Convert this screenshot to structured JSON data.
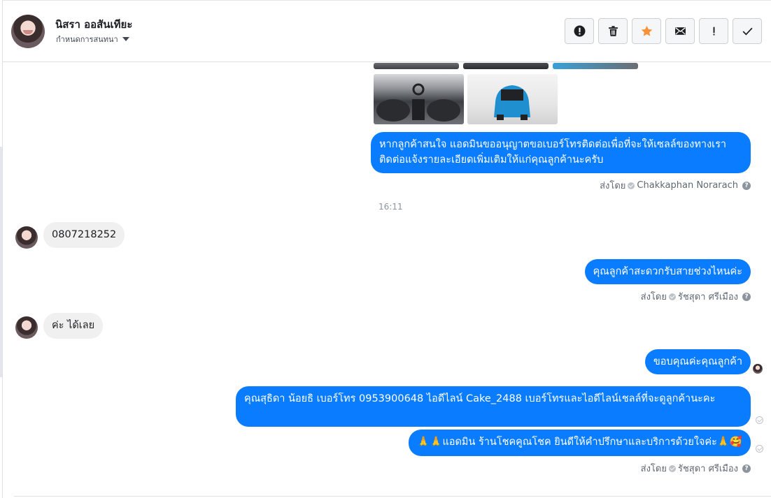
{
  "header": {
    "contact_name": "นิสรา ออสันเทียะ",
    "contact_sub": "กำหนดการสนทนา",
    "actions": [
      {
        "name": "report-spam-button",
        "icon": "alert-circle-icon"
      },
      {
        "name": "delete-button",
        "icon": "trash-icon"
      },
      {
        "name": "star-button",
        "icon": "star-icon"
      },
      {
        "name": "mark-unread-button",
        "icon": "envelope-icon"
      },
      {
        "name": "mark-important-button",
        "icon": "exclamation-icon"
      },
      {
        "name": "mark-done-button",
        "icon": "checkmark-icon"
      }
    ]
  },
  "colors": {
    "outgoing_bubble": "#0a7cff",
    "incoming_bubble": "#f0f0f0",
    "star": "#f7923b"
  },
  "messages": {
    "msg1": "หากลูกค้าสนใจ แอดมินขออนุญาตขอเบอร์โทรติดต่อเพื่อที่จะให้เซลล์ของทางเราติดต่อแจ้งรายละเอียดเพิ่มเติมให้แก่คุณลูกค้านะครับ",
    "msg1_sentby_label": "ส่งโดย",
    "msg1_sentby_name": "Chakkaphan Norarach",
    "time": "16:11",
    "msg2": "0807218252",
    "msg3": "คุณลูกค้าสะดวกรับสายช่วงไหนค่ะ",
    "msg3_sentby_label": "ส่งโดย",
    "msg3_sentby_name": "รัชสุดา ศรีเมือง",
    "msg4": "ค่ะ ได้เลย",
    "msg5": "ขอบคุณค่ะคุณลูกค้า",
    "msg6": "คุณสุธิดา น้อยธิ       เบอร์โทร 0953900648  ไอดีไลน์ Cake_2488   เบอร์โทรและไอดีไลน์เชลล์ที่จะดูลูกค้านะคะ",
    "msg7": "🙏🙏แอดมิน ร้านโชคคูณโชค ยินดีให้คำปรึกษาและบริการด้วยใจค่ะ🙏🥰",
    "msg7_sentby_label": "ส่งโดย",
    "msg7_sentby_name": "รัชสุดา ศรีเมือง"
  }
}
